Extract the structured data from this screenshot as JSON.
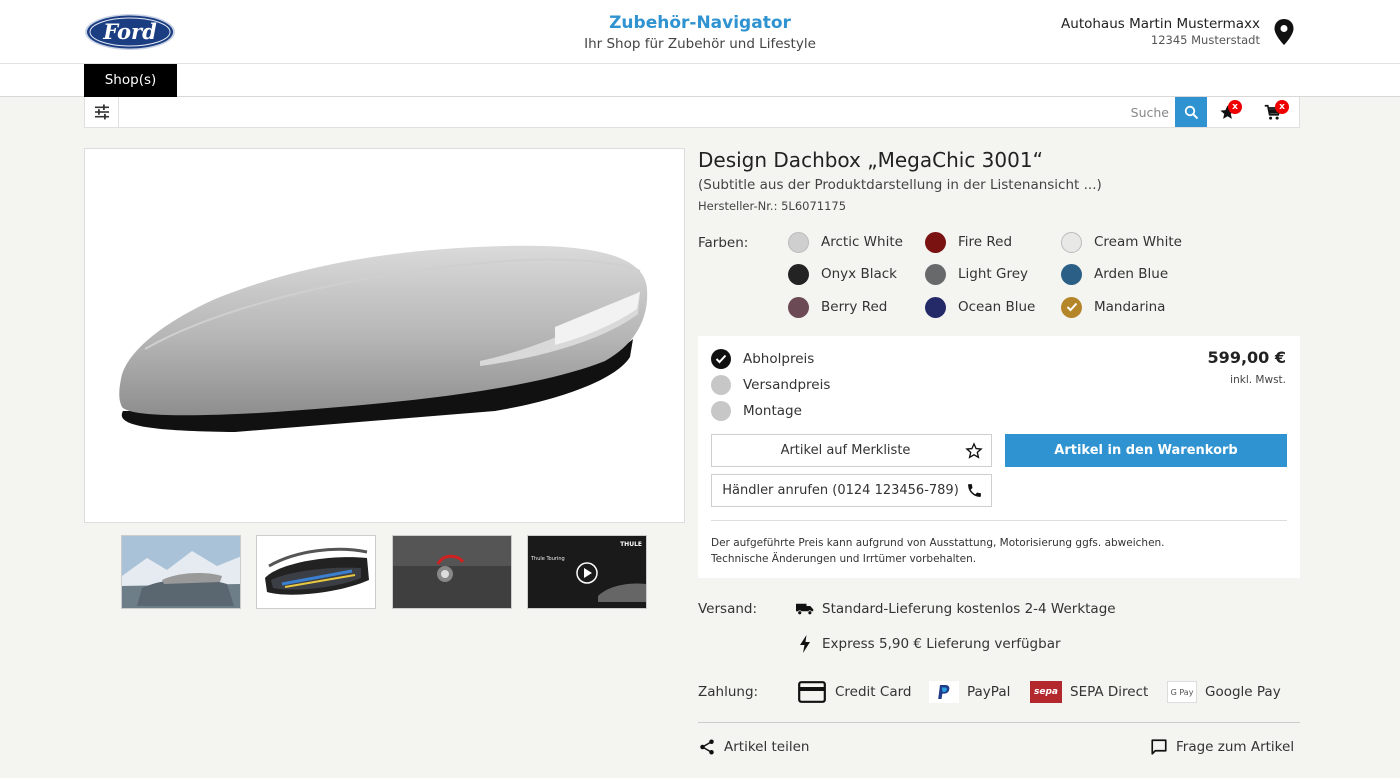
{
  "header": {
    "brand_logo_text": "Ford",
    "title": "Zubehör-Navigator",
    "subtitle": "Ihr Shop für Zubehör und Lifestyle",
    "dealer_name": "Autohaus Martin Mustermaxx",
    "dealer_city": "12345 Musterstadt",
    "location_icon": "map-pin-icon"
  },
  "nav": {
    "shops_label": "Shop(s)"
  },
  "search": {
    "placeholder": "Suche",
    "filter_icon": "filter-sliders-icon",
    "search_icon": "search-icon",
    "wishlist_icon": "star-icon",
    "cart_icon": "cart-icon",
    "wishlist_badge": "x",
    "cart_badge": "x"
  },
  "gallery": {
    "main_image": "roof-box-silver",
    "thumbnails": [
      {
        "name": "roof-box-on-car-mountains"
      },
      {
        "name": "open-roof-box-with-skis"
      },
      {
        "name": "roof-box-lock-detail"
      },
      {
        "name": "thule-video",
        "video_label": "Thule Touring",
        "brand": "THULE"
      }
    ]
  },
  "product": {
    "title": "Design Dachbox „MegaChic 3001“",
    "subtitle": "(Subtitle aus der Produktdarstellung in der Listenansicht ...)",
    "sku": "Hersteller-Nr.: 5L6071175",
    "colors_label": "Farben:",
    "colors": [
      {
        "name": "Arctic White",
        "hex": "#cfcfcf",
        "selected": false
      },
      {
        "name": "Fire Red",
        "hex": "#7a1212",
        "selected": false
      },
      {
        "name": "Cream White",
        "hex": "#e8e8e6",
        "selected": false
      },
      {
        "name": "Onyx Black",
        "hex": "#232323",
        "selected": false
      },
      {
        "name": "Light Grey",
        "hex": "#67696b",
        "selected": false
      },
      {
        "name": "Arden Blue",
        "hex": "#2b5f85",
        "selected": false
      },
      {
        "name": "Berry Red",
        "hex": "#6b4a55",
        "selected": false
      },
      {
        "name": "Ocean Blue",
        "hex": "#242a68",
        "selected": false
      },
      {
        "name": "Mandarina",
        "hex": "#b5852a",
        "selected": true
      }
    ]
  },
  "pricing": {
    "options": [
      {
        "label": "Abholpreis",
        "checked": true
      },
      {
        "label": "Versandpreis",
        "checked": false
      },
      {
        "label": "Montage",
        "checked": false
      }
    ],
    "price": "599,00 €",
    "price_note": "inkl. Mwst.",
    "wishlist_button": "Artikel auf Merkliste",
    "cart_button": "Artikel in den Warenkorb",
    "call_button": "Händler anrufen (0124 123456-789)",
    "disclaimer_line1": "Der aufgeführte Preis kann aufgrund von Ausstattung, Motorisierung ggfs. abweichen.",
    "disclaimer_line2": "Technische Änderungen und Irrtümer vorbehalten."
  },
  "shipping": {
    "label": "Versand:",
    "standard": "Standard-Lieferung kostenlos 2-4 Werktage",
    "express": "Express 5,90 € Lieferung verfügbar"
  },
  "payment": {
    "label": "Zahlung:",
    "methods": [
      {
        "name": "Credit Card",
        "icon": "credit-card-icon"
      },
      {
        "name": "PayPal",
        "icon": "paypal-icon"
      },
      {
        "name": "SEPA Direct",
        "icon": "sepa-icon",
        "icon_text": "sepa"
      },
      {
        "name": "Google Pay",
        "icon": "google-pay-icon",
        "icon_text": "G Pay"
      }
    ]
  },
  "actions": {
    "share": "Artikel teilen",
    "question": "Frage zum Artikel"
  },
  "colors": {
    "accent": "#2e93d0",
    "badge": "#ee0000"
  }
}
